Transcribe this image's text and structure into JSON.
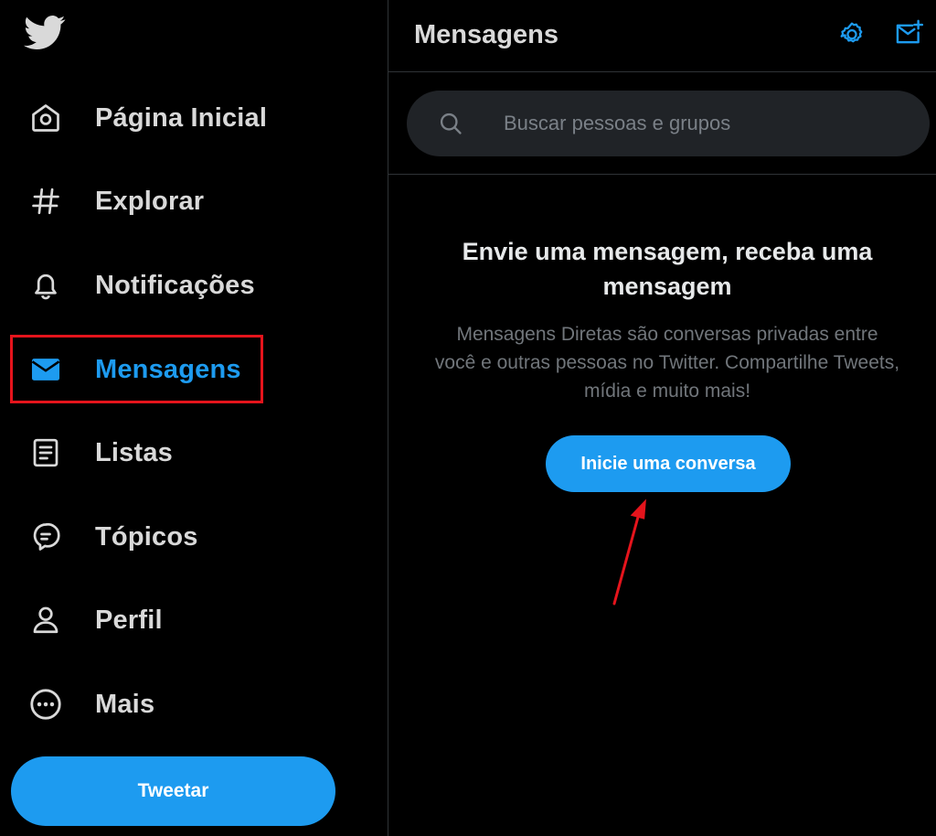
{
  "sidebar": {
    "logo": "twitter-bird-icon",
    "items": [
      {
        "label": "Página Inicial",
        "icon": "home-icon"
      },
      {
        "label": "Explorar",
        "icon": "hashtag-icon"
      },
      {
        "label": "Notificações",
        "icon": "bell-icon"
      },
      {
        "label": "Mensagens",
        "icon": "envelope-icon",
        "active": true
      },
      {
        "label": "Listas",
        "icon": "list-document-icon"
      },
      {
        "label": "Tópicos",
        "icon": "topics-bubble-icon"
      },
      {
        "label": "Perfil",
        "icon": "person-icon"
      },
      {
        "label": "Mais",
        "icon": "more-circle-icon"
      }
    ],
    "tweet_button": "Tweetar"
  },
  "header": {
    "title": "Mensagens",
    "settings_icon": "gear-icon",
    "new_message_icon": "new-message-icon"
  },
  "search": {
    "placeholder": "Buscar pessoas e grupos",
    "value": ""
  },
  "empty_state": {
    "title": "Envie uma mensagem, receba uma mensagem",
    "description": "Mensagens Diretas são conversas privadas entre você e outras pessoas no Twitter. Compartilhe Tweets, mídia e muito mais!",
    "button": "Inicie uma conversa"
  },
  "colors": {
    "accent": "#1d9bf0",
    "background": "#000000",
    "annotation": "#e5141c"
  }
}
